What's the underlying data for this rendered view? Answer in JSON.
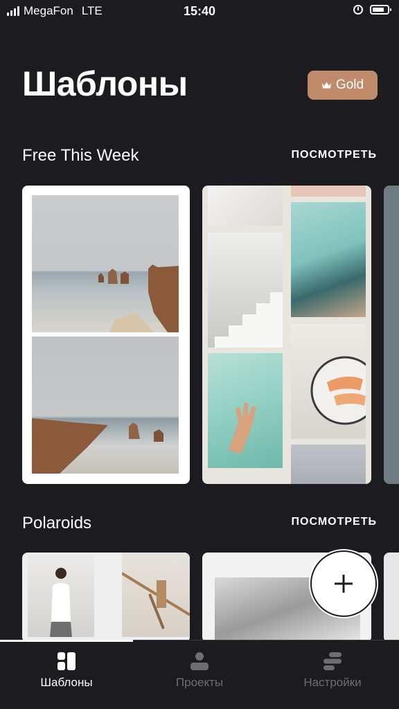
{
  "status_bar": {
    "carrier": "MegaFon",
    "network": "LTE",
    "time": "15:40"
  },
  "header": {
    "title": "Шаблоны",
    "gold_label": "Gold"
  },
  "sections": [
    {
      "title": "Free This Week",
      "see_all": "ПОСМОТРЕТЬ"
    },
    {
      "title": "Polaroids",
      "see_all": "ПОСМОТРЕТЬ"
    }
  ],
  "tabs": [
    {
      "label": "Шаблоны",
      "icon": "templates-icon",
      "active": true
    },
    {
      "label": "Проекты",
      "icon": "projects-icon",
      "active": false
    },
    {
      "label": "Настройки",
      "icon": "settings-icon",
      "active": false
    }
  ],
  "colors": {
    "background": "#1c1b1f",
    "gold_button": "#c08b6b",
    "inactive_tab": "#6e6d72"
  }
}
